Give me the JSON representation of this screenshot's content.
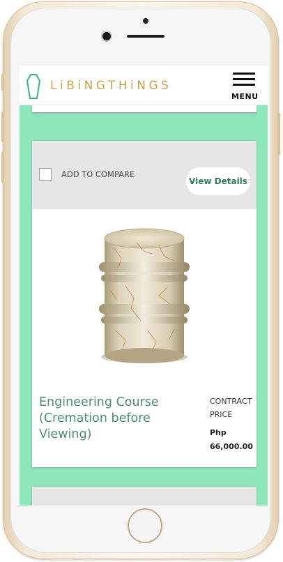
{
  "header": {
    "logo_text": "LiBiNGTHiNGS",
    "menu_label": "MENU"
  },
  "product": {
    "compare_label": "ADD TO COMPARE",
    "compare_checked": false,
    "view_details_label": "View Details",
    "name_line1": "Engineering Course",
    "name_line2": "(Cremation before Viewing)",
    "price_label_line1": "CONTRACT",
    "price_label_line2": "PRICE",
    "price_currency": "Php",
    "price_value": "66,000.00",
    "image_icon": "marble-urn-image"
  },
  "colors": {
    "background": "#8ee6bb",
    "accent_green": "#2e7a5e",
    "logo_gold": "#c8a34a"
  }
}
